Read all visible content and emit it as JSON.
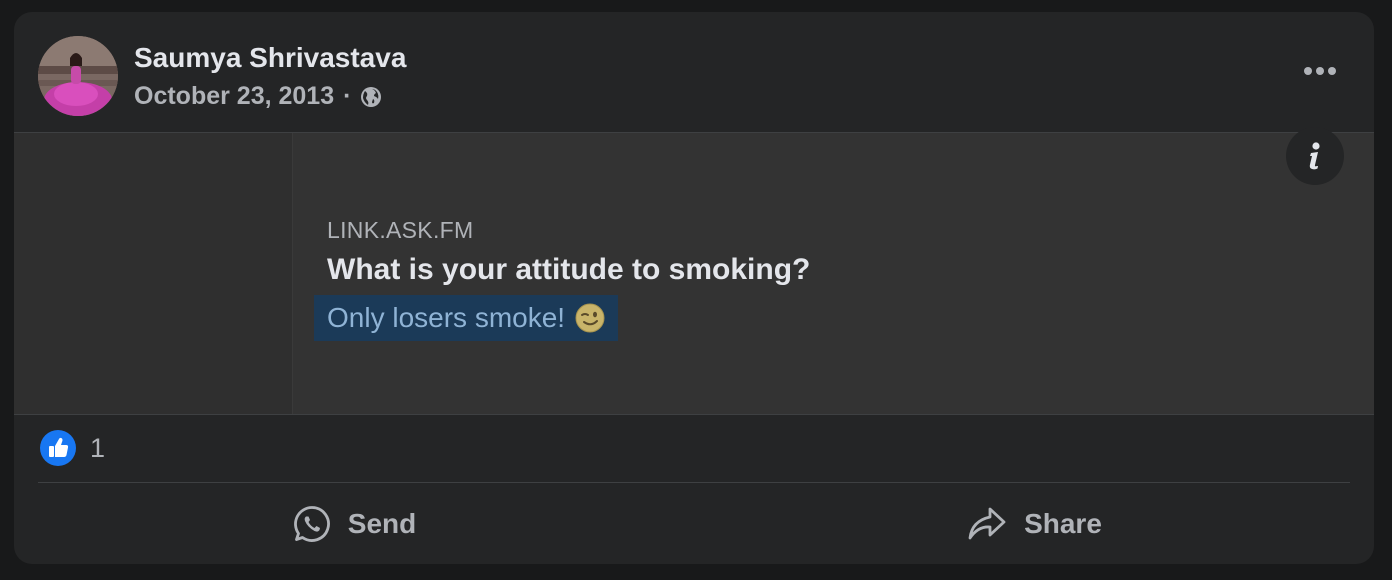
{
  "post": {
    "author": "Saumya Shrivastava",
    "date": "October 23, 2013",
    "separator": "·",
    "privacy_icon": "globe-icon"
  },
  "link_preview": {
    "domain": "LINK.ASK.FM",
    "title": "What is your attitude to smoking?",
    "description": "Only losers smoke!",
    "description_emoji": "winking-face-icon"
  },
  "reactions": {
    "like_icon": "like-icon",
    "count": "1"
  },
  "actions": {
    "send_label": "Send",
    "share_label": "Share"
  },
  "colors": {
    "background": "#18191a",
    "card": "#242526",
    "preview_bg": "#333333",
    "highlight": "#1b3a58",
    "like_blue": "#1877f2",
    "text_primary": "#e4e6eb",
    "text_secondary": "#b0b3b8"
  }
}
